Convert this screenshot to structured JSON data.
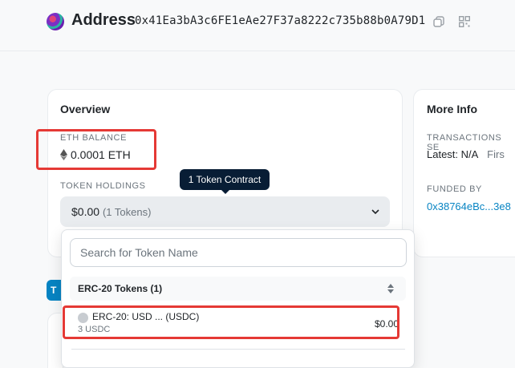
{
  "header": {
    "title": "Address",
    "address": "0x41Ea3bA3c6FE1eAe27F37a8222c735b88b0A79D1",
    "copy_icon": "copy-icon",
    "qr_icon": "qr-code-icon"
  },
  "overview": {
    "title": "Overview",
    "eth_balance_label": "ETH BALANCE",
    "eth_balance_value": "0.0001 ETH",
    "token_holdings_label": "TOKEN HOLDINGS",
    "token_holdings_value": "$0.00",
    "token_holdings_count": "(1 Tokens)",
    "tooltip": "1 Token Contract"
  },
  "dropdown": {
    "search_placeholder": "Search for Token Name",
    "token_type": "ERC-20 Tokens (1)",
    "token": {
      "name": "ERC-20: USD ... (USDC)",
      "balance": "3 USDC",
      "value": "$0.00"
    }
  },
  "more_info": {
    "title": "More Info",
    "transactions_label": "TRANSACTIONS SE",
    "latest": "Latest: N/A",
    "first": "Firs",
    "funded_label": "FUNDED BY",
    "funded_link": "0x38764eBc...3e8"
  },
  "tab_label": "T",
  "colors": {
    "accent": "#0784c3",
    "tooltip_bg": "#081d35",
    "highlight": "#e53935"
  }
}
